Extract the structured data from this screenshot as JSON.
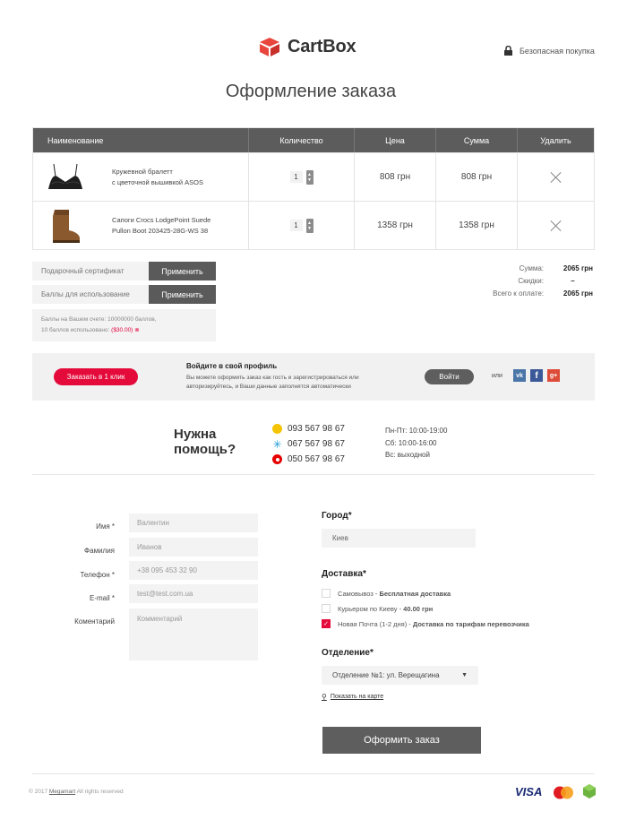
{
  "brand": {
    "name": "CartBox"
  },
  "header": {
    "secure_label": "Безопасная покупка"
  },
  "page_title": "Оформление заказа",
  "cart": {
    "columns": {
      "name": "Наименование",
      "qty": "Количество",
      "price": "Цена",
      "sum": "Сумма",
      "delete": "Удалить"
    },
    "items": [
      {
        "name_line1": "Кружевной бралетт",
        "name_line2": "с цветочной вышивкой ASOS",
        "qty": "1",
        "price": "808 грн",
        "sum": "808 грн"
      },
      {
        "name_line1": "Сапоги Crocs LodgePoint Suede",
        "name_line2": "Pullon Boot 203425-28G-WS 38",
        "qty": "1",
        "price": "1358 грн",
        "sum": "1358 грн"
      }
    ]
  },
  "coupons": {
    "gift_placeholder": "Подарочный сертификат",
    "points_placeholder": "Баллы для использование",
    "apply_label": "Применить",
    "note_line1": "Баллы на Вашем счете: 10000000 баллов,",
    "note_line2_prefix": "10 баллов использовано: ",
    "note_line2_value": "($30.00)"
  },
  "totals": {
    "sum_label": "Сумма:",
    "sum_value": "2065 грн",
    "discount_label": "Скидки:",
    "discount_value": "–",
    "total_label": "Всего к оплате:",
    "total_value": "2065 грн"
  },
  "login_bar": {
    "oneclick_label": "Заказать в 1 клик",
    "title": "Войдите в свой профиль",
    "desc_line1": "Вы можете оформить заказ как гость и зарегистрироваться или",
    "desc_line2": "авторизируйтесь, и Ваши данные заполнятся автоматически",
    "login_label": "Войти",
    "or_label": "или",
    "social": [
      "vk-icon",
      "facebook-icon",
      "google-plus-icon"
    ]
  },
  "help": {
    "title_line1": "Нужна",
    "title_line2": "помощь?",
    "phones": [
      {
        "operator": "lifecell-icon",
        "number": "093 567 98 67"
      },
      {
        "operator": "kyivstar-icon",
        "number": "067 567 98 67"
      },
      {
        "operator": "vodafone-icon",
        "number": "050 567 98 67"
      }
    ],
    "hours": [
      "Пн-Пт: 10:00-19:00",
      "Сб: 10:00-16:00",
      "Вс: выходной"
    ]
  },
  "form": {
    "name_label": "Имя *",
    "name_value": "Валентин",
    "surname_label": "Фамилия",
    "surname_value": "Иванов",
    "phone_label": "Телефон *",
    "phone_value": "+38 095 453 32 90",
    "email_label": "E-mail *",
    "email_value": "test@test.com.ua",
    "comment_label": "Коментарий",
    "comment_placeholder": "Комментарий"
  },
  "city": {
    "title": "Город*",
    "value": "Киев"
  },
  "delivery": {
    "title": "Доставка*",
    "options": [
      {
        "name": "Самовывоз - ",
        "detail": "Бесплатная доставка",
        "checked": false
      },
      {
        "name": "Курьером по Киеву - ",
        "detail": "40.00 грн",
        "checked": false
      },
      {
        "name": "Новая Почта (1-2 дня) - ",
        "detail": "Доставка по тарифам перевозчика",
        "checked": true
      }
    ]
  },
  "branch": {
    "title": "Отделение*",
    "selected": "Отделение №1: ул. Верещагина",
    "map_link": "Показать на карте"
  },
  "order_button": "Оформить заказ",
  "footer": {
    "copyright_prefix": "© 2017 ",
    "copyright_link": "Megamart",
    "copyright_suffix": " All rights reserved",
    "payments": [
      "VISA",
      "mastercard-icon",
      "privatbank-icon"
    ]
  },
  "colors": {
    "accent": "#e40a3a",
    "dark": "#5c5c5c",
    "field": "#f3f3f3"
  }
}
